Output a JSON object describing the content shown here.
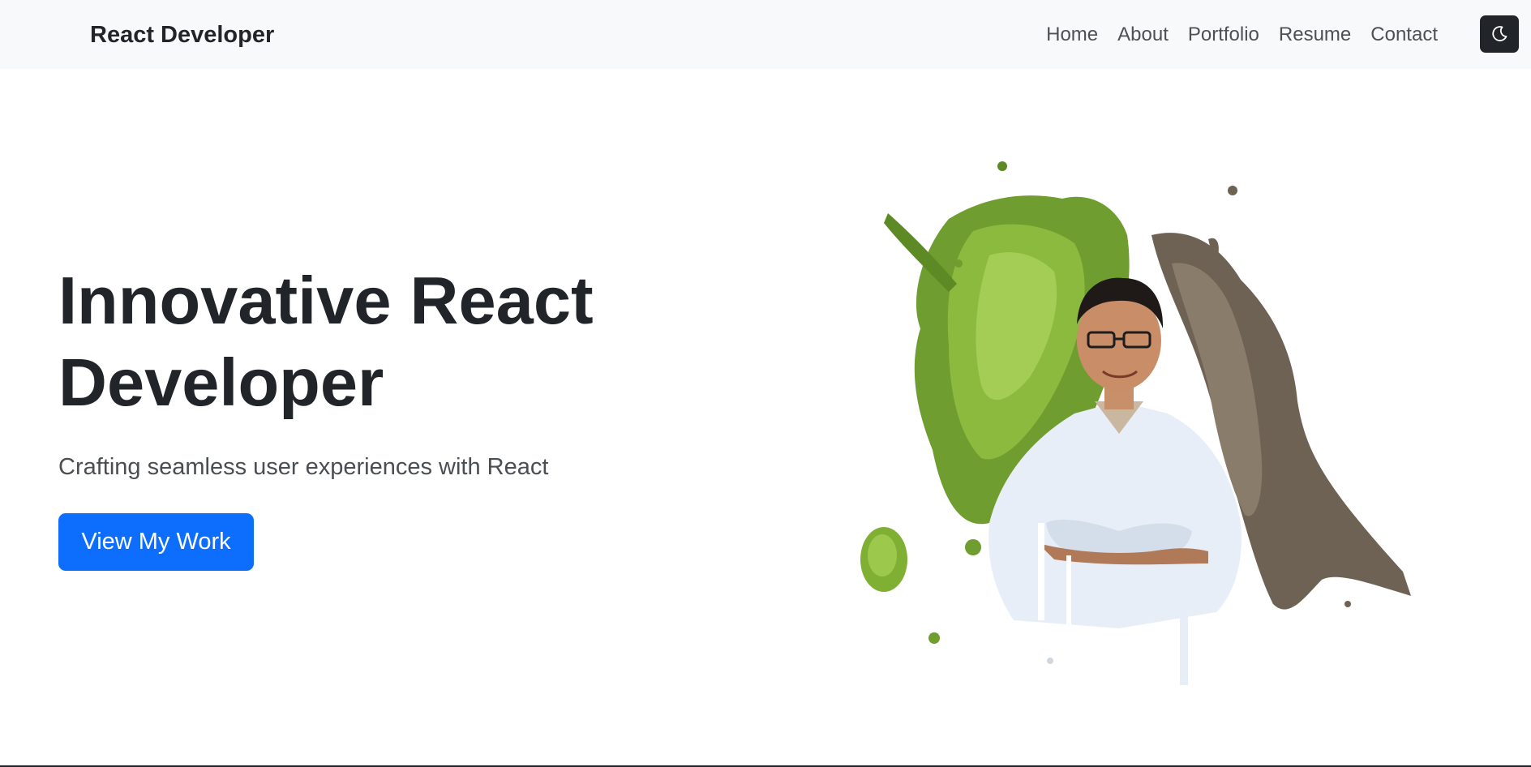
{
  "navbar": {
    "brand": "React Developer",
    "links": [
      {
        "label": "Home"
      },
      {
        "label": "About"
      },
      {
        "label": "Portfolio"
      },
      {
        "label": "Resume"
      },
      {
        "label": "Contact"
      }
    ],
    "theme_toggle_icon": "moon-icon"
  },
  "hero": {
    "title_line1": "Innovative React",
    "title_line2": "Developer",
    "subtitle": "Crafting seamless user experiences with React",
    "cta_label": "View My Work"
  },
  "colors": {
    "navbar_bg": "#f8f9fa",
    "text_dark": "#212529",
    "primary": "#0d6efd",
    "toggle_bg": "#212529"
  }
}
